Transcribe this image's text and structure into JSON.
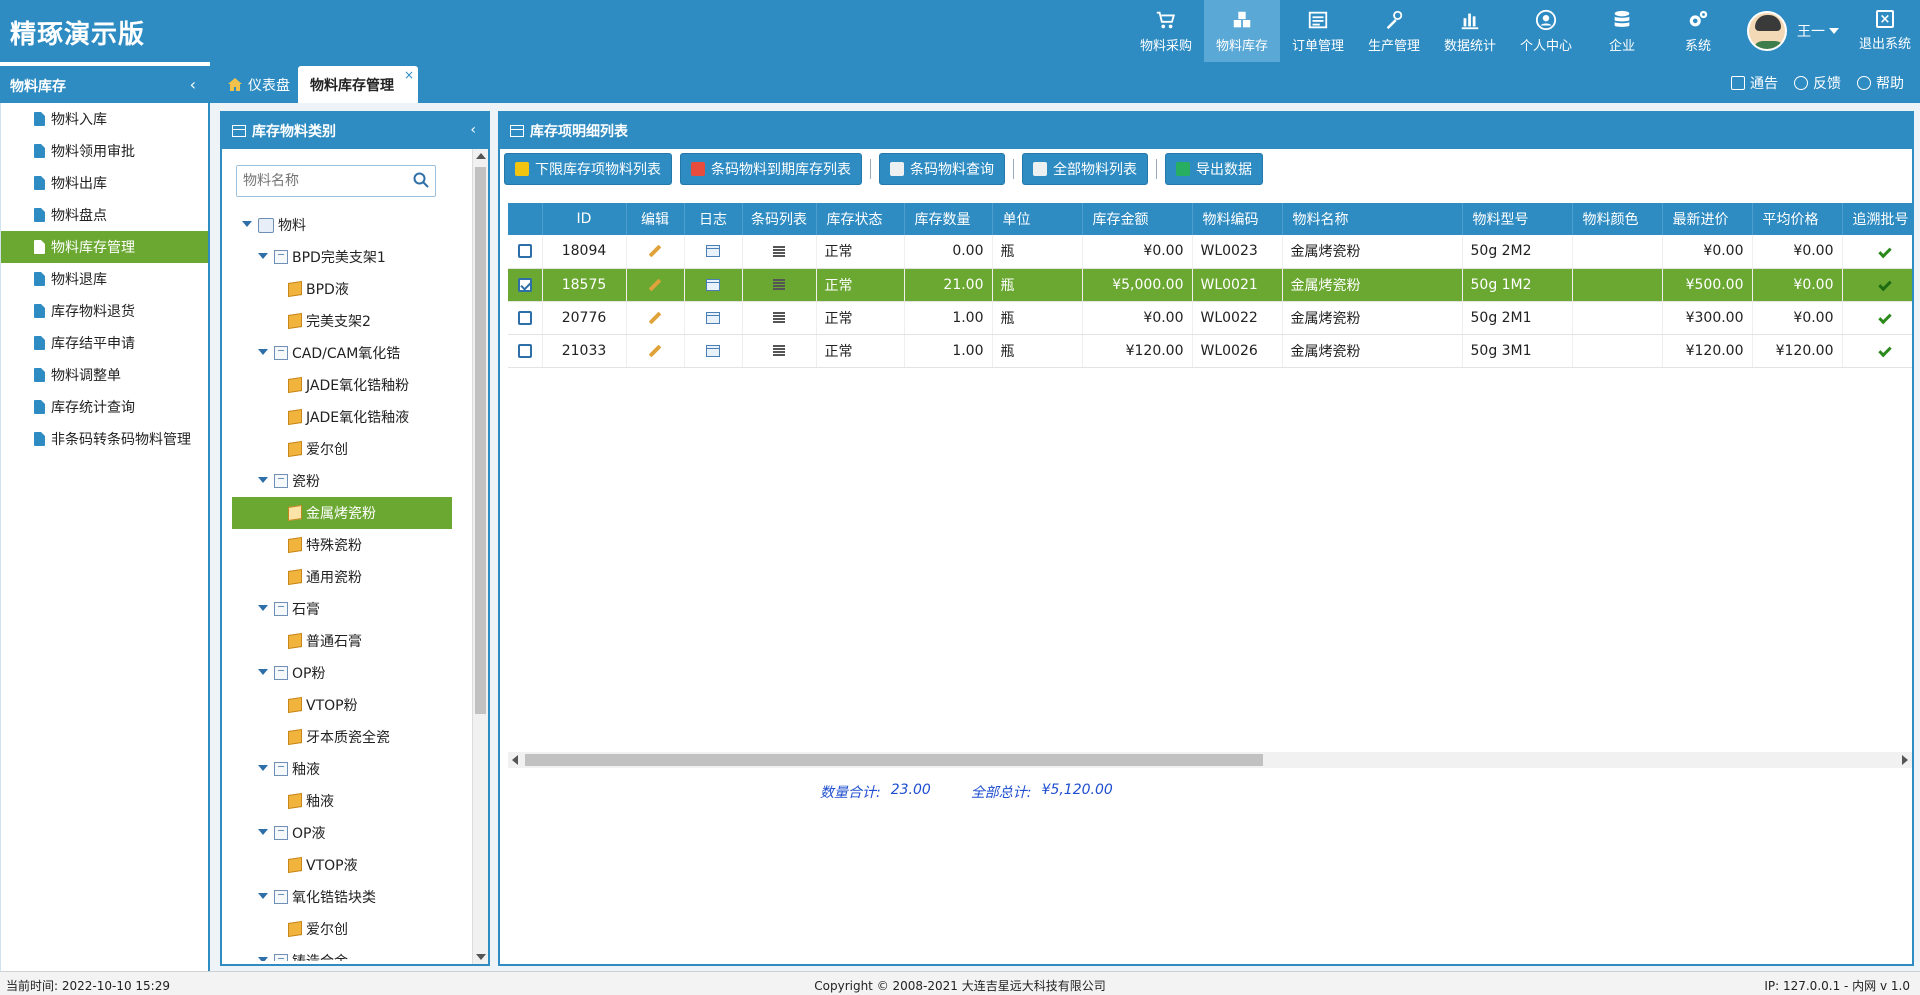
{
  "app": {
    "title": "精琢演示版"
  },
  "topnav": [
    {
      "label": "物料采购",
      "icon": "cart-icon"
    },
    {
      "label": "物料库存",
      "icon": "boxes-icon",
      "active": true
    },
    {
      "label": "订单管理",
      "icon": "list-icon"
    },
    {
      "label": "生产管理",
      "icon": "tools-icon"
    },
    {
      "label": "数据统计",
      "icon": "bar-chart-icon"
    },
    {
      "label": "个人中心",
      "icon": "user-icon"
    },
    {
      "label": "企业",
      "icon": "database-icon"
    },
    {
      "label": "系统",
      "icon": "gears-icon"
    }
  ],
  "user": {
    "name": "王一",
    "logout": "退出系统"
  },
  "sidebar": {
    "title": "物料库存",
    "items": [
      {
        "label": "物料入库"
      },
      {
        "label": "物料领用审批"
      },
      {
        "label": "物料出库"
      },
      {
        "label": "物料盘点"
      },
      {
        "label": "物料库存管理",
        "active": true
      },
      {
        "label": "物料退库"
      },
      {
        "label": "库存物料退货"
      },
      {
        "label": "库存结平申请"
      },
      {
        "label": "物料调整单"
      },
      {
        "label": "库存统计查询"
      },
      {
        "label": "非条码转条码物料管理"
      }
    ]
  },
  "tabs": [
    {
      "label": "仪表盘"
    },
    {
      "label": "物料库存管理",
      "active": true
    }
  ],
  "topright": {
    "notice": "通告",
    "feedback": "反馈",
    "help": "帮助"
  },
  "category_panel": {
    "title": "库存物料类别",
    "search_placeholder": "物料名称",
    "tree": [
      {
        "label": "物料",
        "level": 0,
        "type": "root"
      },
      {
        "label": "BPD完美支架1",
        "level": 1,
        "type": "folder"
      },
      {
        "label": "BPD液",
        "level": 2,
        "type": "item"
      },
      {
        "label": "完美支架2",
        "level": 2,
        "type": "item"
      },
      {
        "label": "CAD/CAM氧化锆",
        "level": 1,
        "type": "folder"
      },
      {
        "label": "JADE氧化锆釉粉",
        "level": 2,
        "type": "item"
      },
      {
        "label": "JADE氧化锆釉液",
        "level": 2,
        "type": "item"
      },
      {
        "label": "爱尔创",
        "level": 2,
        "type": "item"
      },
      {
        "label": "瓷粉",
        "level": 1,
        "type": "folder"
      },
      {
        "label": "金属烤瓷粉",
        "level": 2,
        "type": "item",
        "active": true
      },
      {
        "label": "特殊瓷粉",
        "level": 2,
        "type": "item"
      },
      {
        "label": "通用瓷粉",
        "level": 2,
        "type": "item"
      },
      {
        "label": "石膏",
        "level": 1,
        "type": "folder"
      },
      {
        "label": "普通石膏",
        "level": 2,
        "type": "item"
      },
      {
        "label": "OP粉",
        "level": 1,
        "type": "folder"
      },
      {
        "label": "VTOP粉",
        "level": 2,
        "type": "item"
      },
      {
        "label": "牙本质瓷全瓷",
        "level": 2,
        "type": "item"
      },
      {
        "label": "釉液",
        "level": 1,
        "type": "folder"
      },
      {
        "label": "釉液",
        "level": 2,
        "type": "item"
      },
      {
        "label": "OP液",
        "level": 1,
        "type": "folder"
      },
      {
        "label": "VTOP液",
        "level": 2,
        "type": "item"
      },
      {
        "label": "氧化锆锆块类",
        "level": 1,
        "type": "folder"
      },
      {
        "label": "爱尔创",
        "level": 2,
        "type": "item"
      },
      {
        "label": "铸造合金",
        "level": 1,
        "type": "folder"
      }
    ]
  },
  "list_panel": {
    "title": "库存项明细列表",
    "buttons": [
      {
        "label": "下限库存项物料列表",
        "color": "#f1c40f"
      },
      {
        "label": "条码物料到期库存列表",
        "color": "#e74c3c"
      },
      {
        "label": "条码物料查询",
        "color": "#ecf0f1"
      },
      {
        "label": "全部物料列表",
        "color": "#ecf0f1"
      },
      {
        "label": "导出数据",
        "color": "#27ae60"
      }
    ],
    "columns": [
      "",
      "ID",
      "编辑",
      "日志",
      "条码列表",
      "库存状态",
      "库存数量",
      "单位",
      "库存金额",
      "物料编码",
      "物料名称",
      "物料型号",
      "物料颜色",
      "最新进价",
      "平均价格",
      "追溯批号"
    ],
    "rows": [
      {
        "checked": false,
        "id": "18094",
        "status": "正常",
        "qty": "0.00",
        "unit": "瓶",
        "amount": "¥0.00",
        "code": "WL0023",
        "name": "金属烤瓷粉",
        "model": "50g 2M2",
        "color": "",
        "last_price": "¥0.00",
        "avg_price": "¥0.00",
        "trace": true
      },
      {
        "checked": true,
        "id": "18575",
        "status": "正常",
        "qty": "21.00",
        "unit": "瓶",
        "amount": "¥5,000.00",
        "code": "WL0021",
        "name": "金属烤瓷粉",
        "model": "50g 1M2",
        "color": "",
        "last_price": "¥500.00",
        "avg_price": "¥0.00",
        "trace": true
      },
      {
        "checked": false,
        "id": "20776",
        "status": "正常",
        "qty": "1.00",
        "unit": "瓶",
        "amount": "¥0.00",
        "code": "WL0022",
        "name": "金属烤瓷粉",
        "model": "50g 2M1",
        "color": "",
        "last_price": "¥300.00",
        "avg_price": "¥0.00",
        "trace": true
      },
      {
        "checked": false,
        "id": "21033",
        "status": "正常",
        "qty": "1.00",
        "unit": "瓶",
        "amount": "¥120.00",
        "code": "WL0026",
        "name": "金属烤瓷粉",
        "model": "50g 3M1",
        "color": "",
        "last_price": "¥120.00",
        "avg_price": "¥120.00",
        "trace": true
      }
    ],
    "summary": {
      "qty_label": "数量合计:",
      "qty_value": "23.00",
      "total_label": "全部总计:",
      "total_value": "¥5,120.00"
    }
  },
  "footer": {
    "time": "当前时间:  2022-10-10 15:29",
    "copyright": "Copyright © 2008-2021 大连吉星远大科技有限公司",
    "ip": "IP: 127.0.0.1 - 内网    v 1.0"
  }
}
